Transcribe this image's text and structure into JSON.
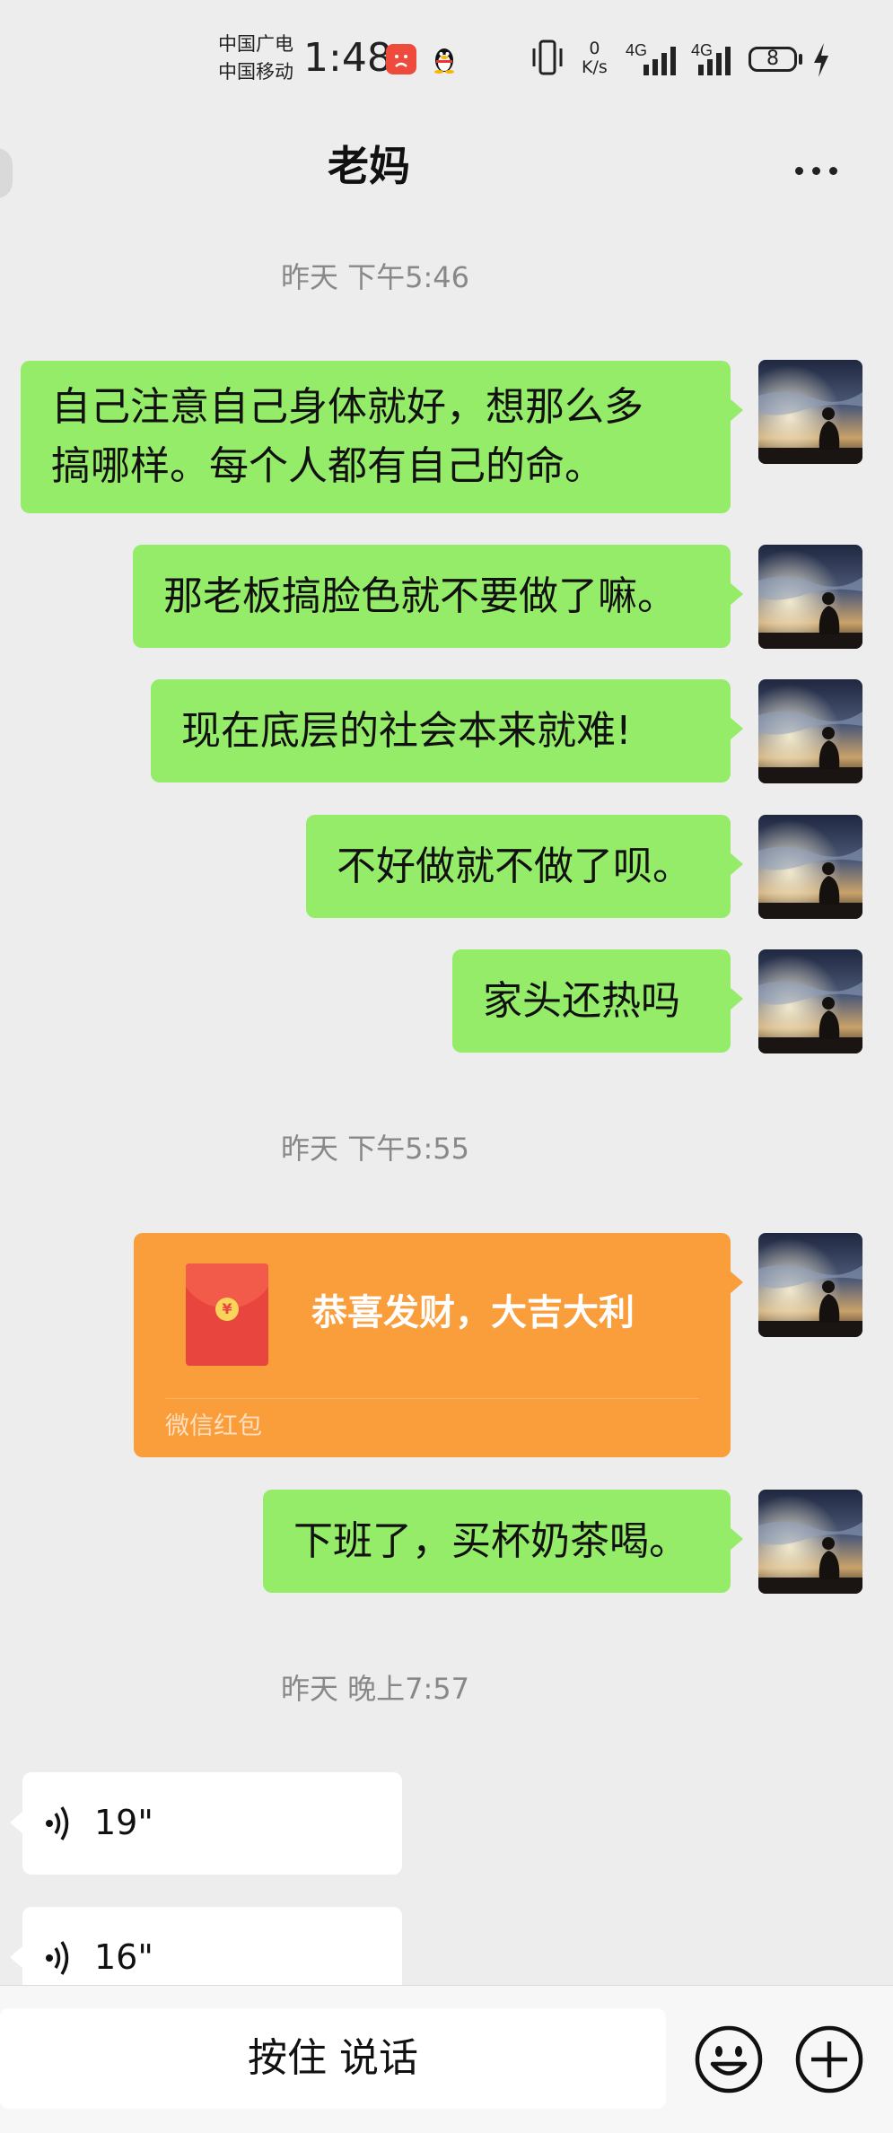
{
  "status_bar": {
    "carrier_1": "中国广电",
    "carrier_2": "中国移动",
    "time": "1:48",
    "net_speed_value": "0",
    "net_speed_unit": "K/s",
    "sim1_type": "4G",
    "sim2_type": "4G",
    "battery_level": "8"
  },
  "header": {
    "title": "老妈"
  },
  "messages": [
    {
      "type": "timestamp",
      "text": "昨天 下午5:46"
    },
    {
      "type": "text",
      "side": "right",
      "lines": [
        "自己注意自己身体就好，想那么多",
        "搞哪样。每个人都有自己的命。"
      ]
    },
    {
      "type": "text",
      "side": "right",
      "text": "那老板搞脸色就不要做了嘛。"
    },
    {
      "type": "text",
      "side": "right",
      "text": "现在底层的社会本来就难!"
    },
    {
      "type": "text",
      "side": "right",
      "text": "不好做就不做了呗。"
    },
    {
      "type": "text",
      "side": "right",
      "text": "家头还热吗"
    },
    {
      "type": "timestamp",
      "text": "昨天 下午5:55"
    },
    {
      "type": "red_packet",
      "side": "right",
      "greeting": "恭喜发财，大吉大利",
      "label": "微信红包",
      "coin": "¥"
    },
    {
      "type": "text",
      "side": "right",
      "text": "下班了，买杯奶茶喝。"
    },
    {
      "type": "timestamp",
      "text": "昨天 晚上7:57"
    },
    {
      "type": "voice",
      "side": "left",
      "duration": "19\""
    },
    {
      "type": "voice",
      "side": "left",
      "duration": "16\""
    }
  ],
  "input_bar": {
    "push_to_talk_label": "按住 说话"
  },
  "colors": {
    "background": "#ededed",
    "my_bubble": "#95ec69",
    "red_packet": "#fa9d3b",
    "their_bubble": "#ffffff"
  },
  "icons": [
    "signal-icon",
    "vibrate-icon",
    "battery-icon",
    "more-icon",
    "voice-wave-icon",
    "emoji-icon",
    "plus-icon"
  ]
}
